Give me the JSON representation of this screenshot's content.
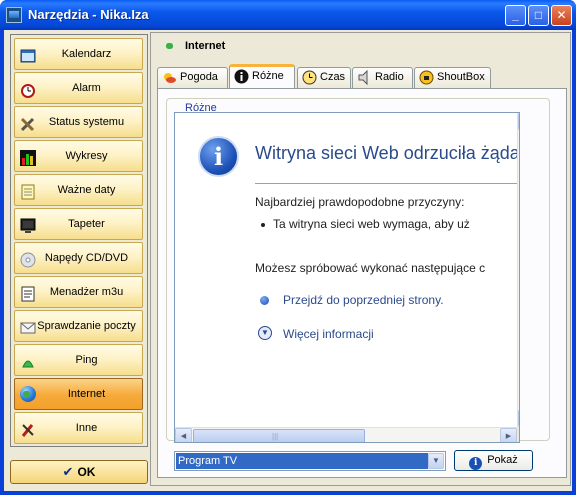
{
  "window": {
    "title": "Narzędzia - Nika.Iza",
    "min_glyph": "_",
    "max_glyph": "□",
    "close_glyph": "✕"
  },
  "nav": {
    "items": [
      {
        "label": "Kalendarz",
        "icon": "calendar-icon"
      },
      {
        "label": "Alarm",
        "icon": "alarm-clock-icon"
      },
      {
        "label": "Status systemu",
        "icon": "tools-icon"
      },
      {
        "label": "Wykresy",
        "icon": "bar-chart-icon"
      },
      {
        "label": "Ważne daty",
        "icon": "notepad-icon"
      },
      {
        "label": "Tapeter",
        "icon": "monitor-icon"
      },
      {
        "label": "Napędy CD/DVD",
        "icon": "cd-icon"
      },
      {
        "label": "Menadżer m3u",
        "icon": "playlist-icon"
      },
      {
        "label": "Sprawdzanie poczty",
        "icon": "mail-icon"
      },
      {
        "label": "Ping",
        "icon": "ping-icon"
      },
      {
        "label": "Internet",
        "icon": "globe-icon",
        "active": true
      },
      {
        "label": "Inne",
        "icon": "misc-tools-icon"
      }
    ],
    "ok_label": "OK",
    "ok_glyph": "✔"
  },
  "panel": {
    "title": "Internet",
    "tabs": [
      {
        "label": "Pogoda",
        "icon": "weather-icon"
      },
      {
        "label": "Różne",
        "icon": "info-icon",
        "active": true
      },
      {
        "label": "Czas",
        "icon": "clock-icon"
      },
      {
        "label": "Radio",
        "icon": "speaker-icon"
      },
      {
        "label": "ShoutBox",
        "icon": "shoutbox-icon"
      }
    ],
    "group_label": "Różne",
    "browser": {
      "heading": "Witryna sieci Web odrzuciła żąda",
      "causes_title": "Najbardziej prawdopodobne przyczyny:",
      "cause_1": "Ta witryna sieci web wymaga, aby uż",
      "try_text": "Możesz spróbować wykonać następujące c",
      "back_link": "Przejdź do poprzedniej strony.",
      "more_link": "Więcej informacji"
    },
    "select_value": "Program TV",
    "show_label": "Pokaż"
  },
  "colors": {
    "title_bar": "#0a58ea",
    "nav_active": "#f6a93a",
    "accent_link": "#2b4a8c",
    "selection": "#316ac5"
  }
}
